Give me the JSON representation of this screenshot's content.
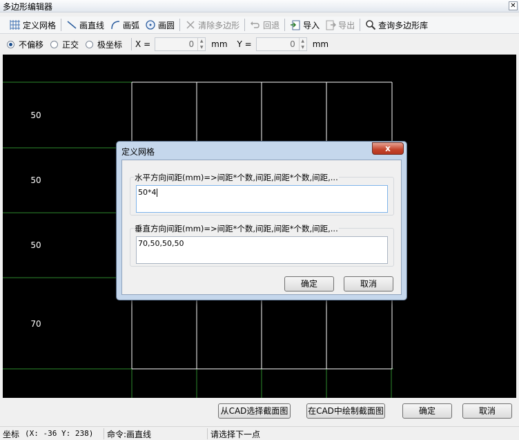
{
  "window": {
    "title": "多边形编辑器",
    "close_glyph": "✕"
  },
  "toolbar": {
    "items": [
      {
        "label": "定义网格",
        "icon": "grid-icon"
      },
      {
        "label": "画直线",
        "icon": "line-icon"
      },
      {
        "label": "画弧",
        "icon": "arc-icon"
      },
      {
        "label": "画圆",
        "icon": "circle-icon"
      },
      {
        "label": "清除多边形",
        "icon": "clear-icon"
      },
      {
        "label": "回退",
        "icon": "undo-icon"
      },
      {
        "label": "导入",
        "icon": "import-icon"
      },
      {
        "label": "导出",
        "icon": "export-icon"
      },
      {
        "label": "查询多边形库",
        "icon": "search-icon"
      }
    ]
  },
  "options": {
    "modes": [
      "不偏移",
      "正交",
      "极坐标"
    ],
    "selected_mode": "不偏移",
    "x_label": "X =",
    "x_value": "0",
    "x_unit": "mm",
    "y_label": "Y =",
    "y_value": "0",
    "y_unit": "mm"
  },
  "canvas": {
    "row_labels": [
      "50",
      "50",
      "50",
      "70"
    ],
    "grid_color": "#ffffff",
    "axis_color": "#2e8b2e",
    "background": "#000000"
  },
  "dialog": {
    "title": "定义网格",
    "close_glyph": "x",
    "horizontal": {
      "label": "水平方向间距(mm)=>间距*个数,间距,间距*个数,间距,...",
      "value": "50*4"
    },
    "vertical": {
      "label": "垂直方向间距(mm)=>间距*个数,间距,间距*个数,间距,...",
      "value": "70,50,50,50"
    },
    "ok_label": "确定",
    "cancel_label": "取消"
  },
  "bottom": {
    "select_from_cad": "从CAD选择截面图",
    "draw_in_cad": "在CAD中绘制截面图",
    "ok_label": "确定",
    "cancel_label": "取消"
  },
  "status": {
    "coord_label": "坐标",
    "coord_value": "(X: -36 Y: 238)",
    "command": "命令:画直线",
    "prompt": "请选择下一点"
  }
}
